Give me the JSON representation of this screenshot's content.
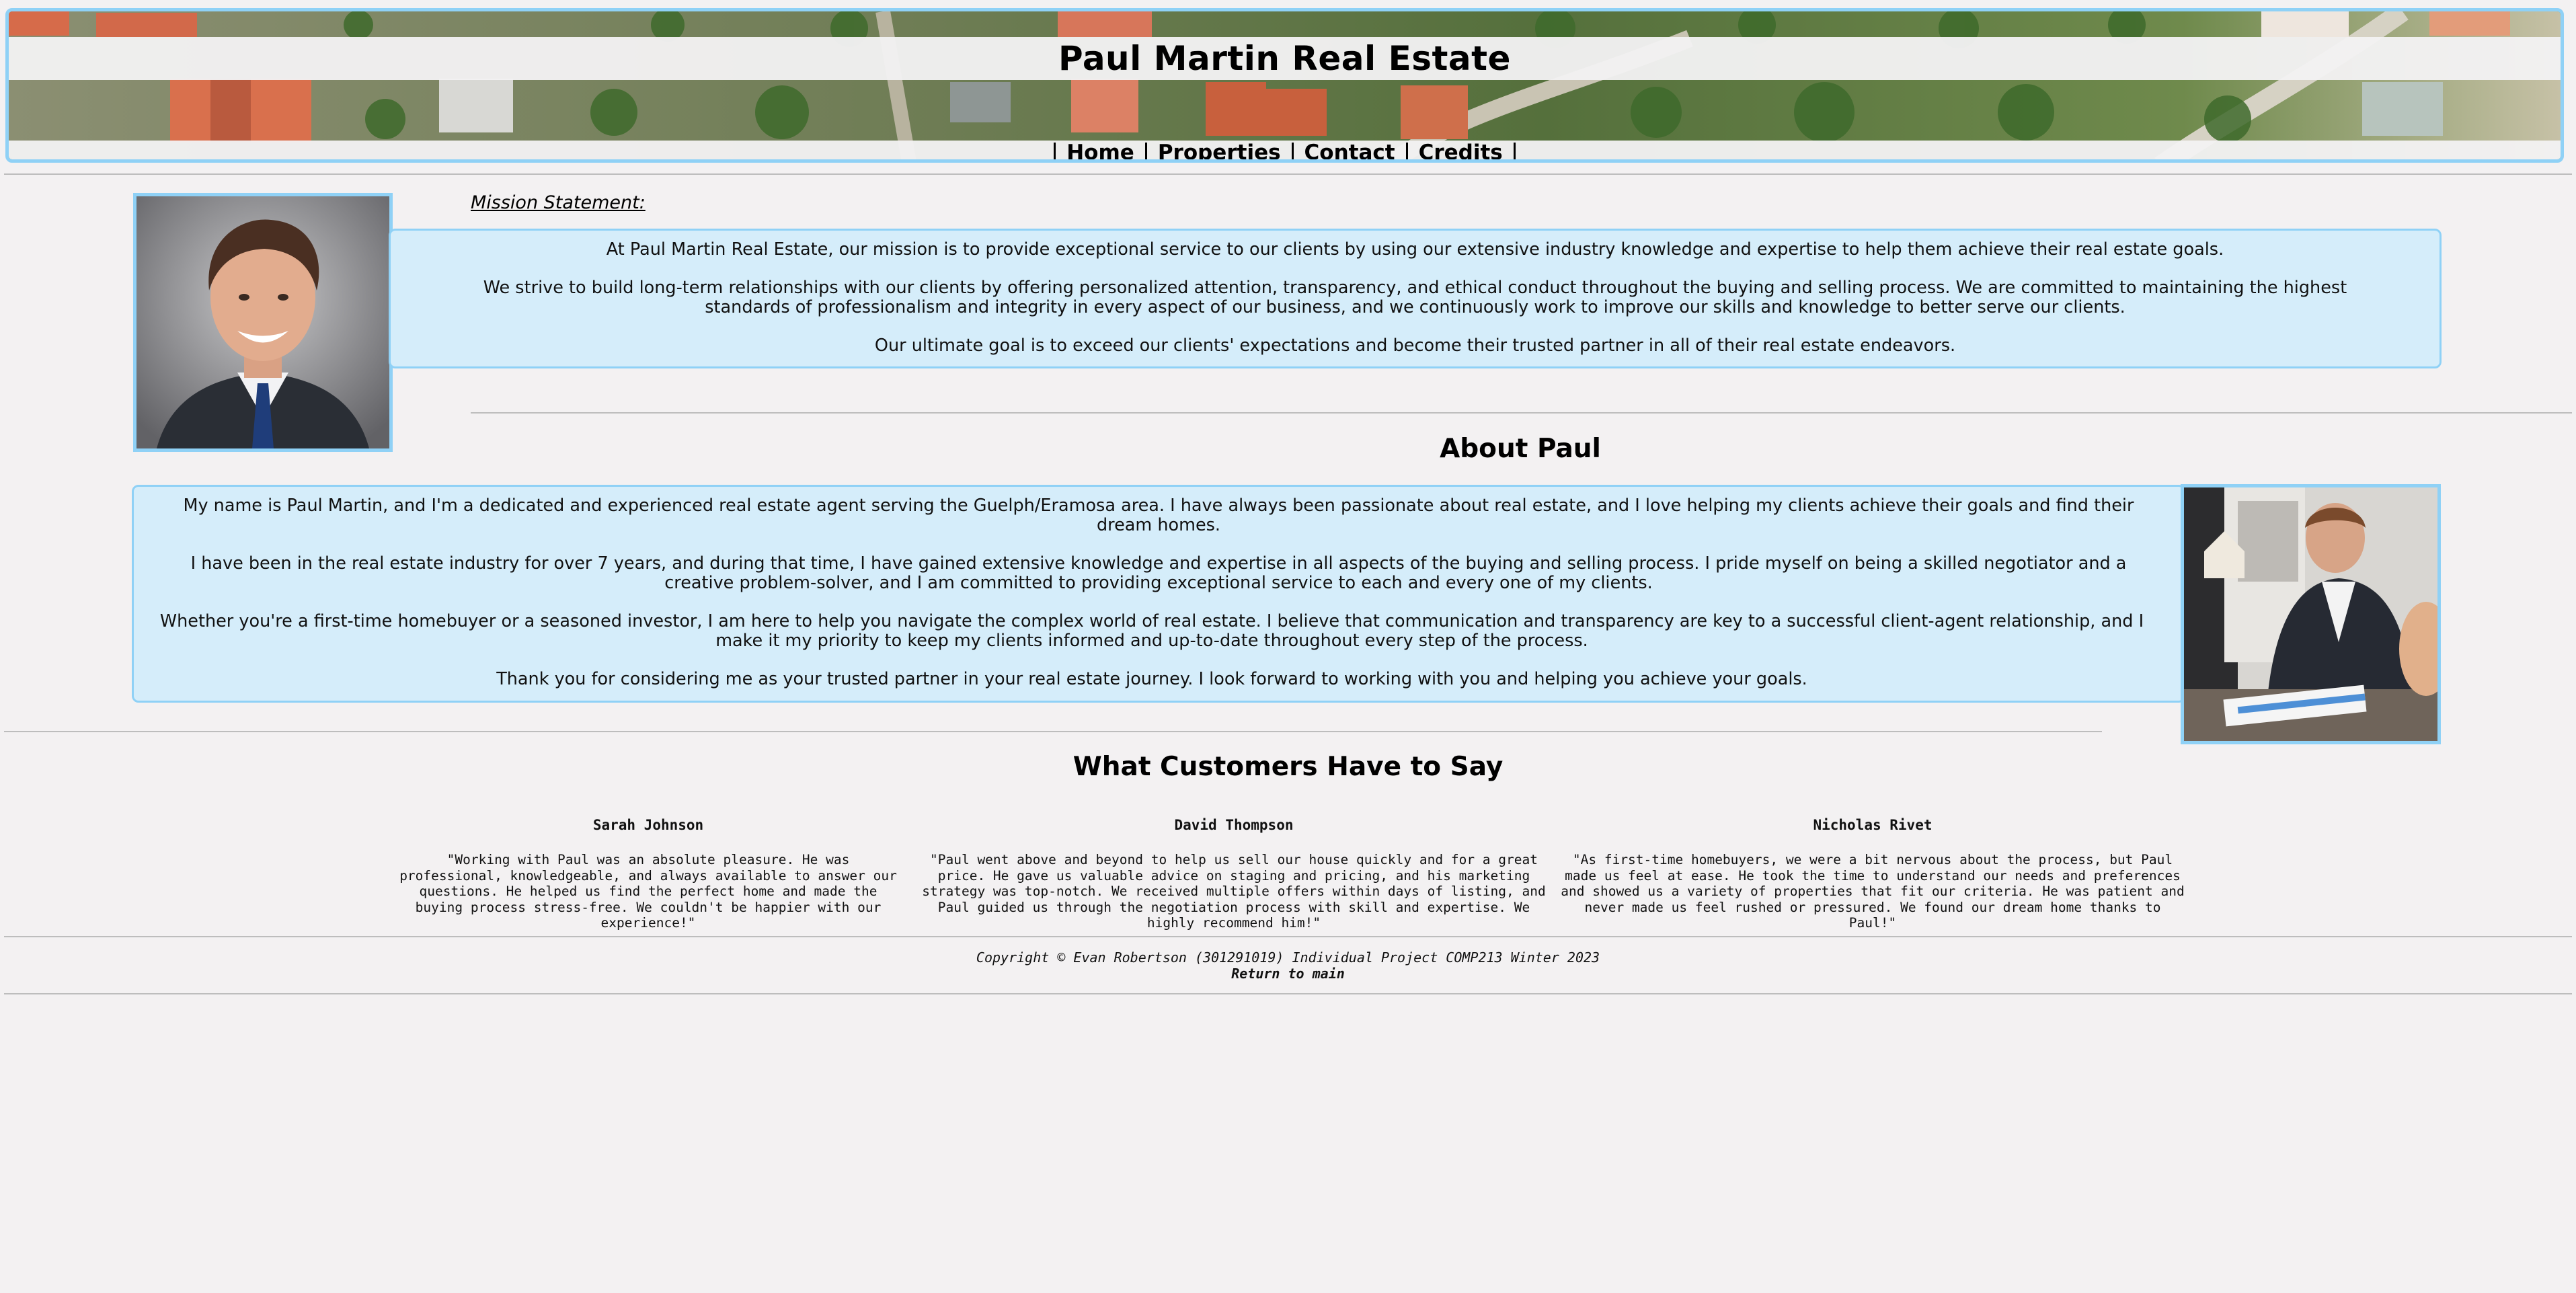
{
  "site": {
    "title": "Paul Martin Real Estate"
  },
  "nav": {
    "items": [
      "Home",
      "Properties",
      "Contact",
      "Credits"
    ]
  },
  "mission": {
    "label": "Mission Statement:",
    "paragraphs": [
      "At Paul Martin Real Estate, our mission is to provide exceptional service to our clients by using our extensive industry knowledge and expertise to help them achieve their real estate goals.",
      "We strive to build long-term relationships with our clients by offering personalized attention, transparency, and ethical conduct throughout the buying and selling process. We are committed to maintaining the highest standards of professionalism and integrity in every aspect of our business, and we continuously work to improve our skills and knowledge to better serve our clients.",
      "Our ultimate goal is to exceed our clients' expectations and become their trusted partner in all of their real estate endeavors."
    ]
  },
  "about": {
    "title": "About Paul",
    "paragraphs": [
      "My name is Paul Martin, and I'm a dedicated and experienced real estate agent serving the Guelph/Eramosa area. I have always been passionate about real estate, and I love helping my clients achieve their goals and find their dream homes.",
      "I have been in the real estate industry for over 7 years, and during that time, I have gained extensive knowledge and expertise in all aspects of the buying and selling process. I pride myself on being a skilled negotiator and a creative problem-solver, and I am committed to providing exceptional service to each and every one of my clients.",
      "Whether you're a first-time homebuyer or a seasoned investor, I am here to help you navigate the complex world of real estate. I believe that communication and transparency are key to a successful client-agent relationship, and I make it my priority to keep my clients informed and up-to-date throughout every step of the process.",
      "Thank you for considering me as your trusted partner in your real estate journey. I look forward to working with you and helping you achieve your goals."
    ]
  },
  "testimonials": {
    "title": "What Customers Have to Say",
    "items": [
      {
        "name": "Sarah Johnson",
        "quote": "\"Working with Paul was an absolute pleasure. He was professional, knowledgeable, and always available to answer our questions. He helped us find the perfect home and made the buying process stress-free. We couldn't be happier with our experience!\""
      },
      {
        "name": "David Thompson",
        "quote": "\"Paul went above and beyond to help us sell our house quickly and for a great price. He gave us valuable advice on staging and pricing, and his marketing strategy was top-notch. We received multiple offers within days of listing, and Paul guided us through the negotiation process with skill and expertise. We highly recommend him!\""
      },
      {
        "name": "Nicholas Rivet",
        "quote": "\"As first-time homebuyers, we were a bit nervous about the process, but Paul made us feel at ease. He took the time to understand our needs and preferences and showed us a variety of properties that fit our criteria. He was patient and never made us feel rushed or pressured. We found our dream home thanks to Paul!\""
      }
    ]
  },
  "footer": {
    "copyright": "Copyright © Evan Robertson (301291019) Individual Project COMP213 Winter 2023",
    "return_link": "Return to main"
  }
}
